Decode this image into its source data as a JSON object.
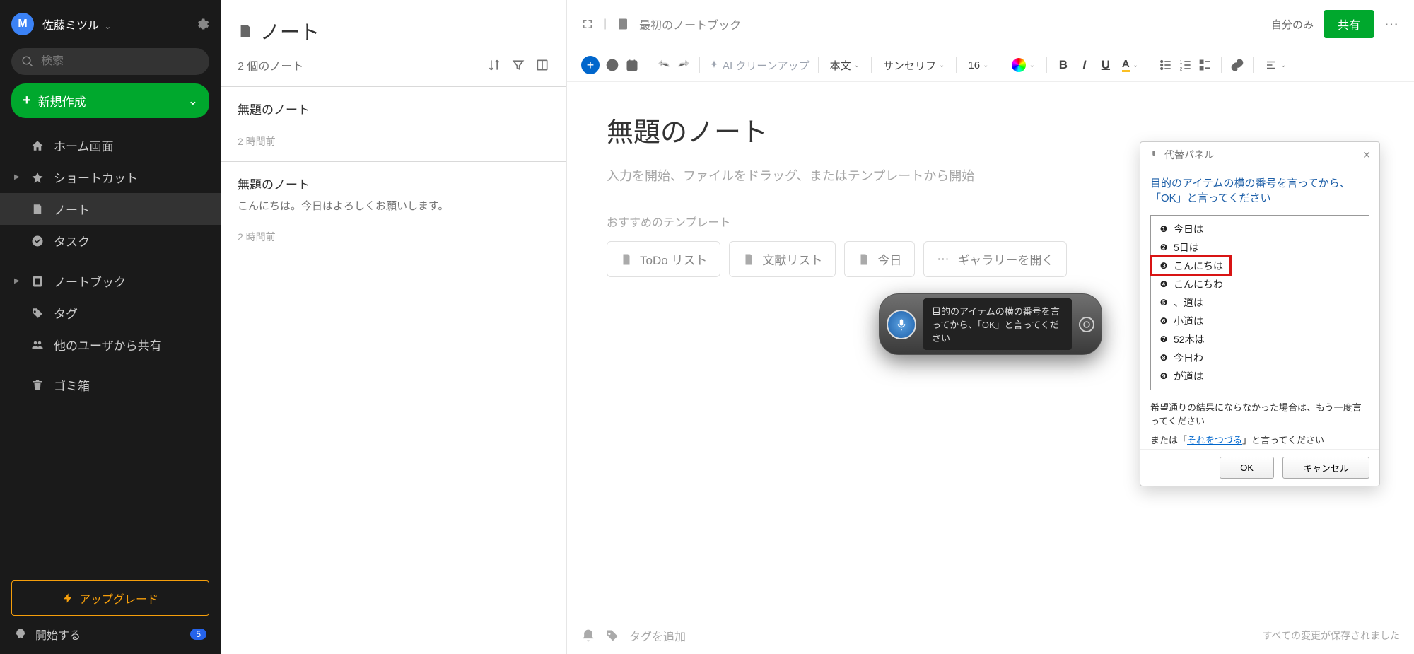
{
  "sidebar": {
    "avatar_letter": "M",
    "username": "佐藤ミツル",
    "search_placeholder": "検索",
    "new_button": "新規作成",
    "nav": {
      "home": "ホーム画面",
      "shortcuts": "ショートカット",
      "notes": "ノート",
      "tasks": "タスク",
      "notebooks": "ノートブック",
      "tags": "タグ",
      "shared": "他のユーザから共有",
      "trash": "ゴミ箱"
    },
    "upgrade": "アップグレード",
    "getstarted": "開始する",
    "getstarted_badge": "5"
  },
  "notelist": {
    "title": "ノート",
    "count": "2 個のノート",
    "items": [
      {
        "title": "無題のノート",
        "preview": "",
        "time": "2 時間前"
      },
      {
        "title": "無題のノート",
        "preview": "こんにちは。今日はよろしくお願いします。",
        "time": "2 時間前"
      }
    ]
  },
  "editor": {
    "notebook": "最初のノートブック",
    "visibility": "自分のみ",
    "share": "共有",
    "toolbar": {
      "ai": "AI クリーンアップ",
      "style": "本文",
      "font": "サンセリフ",
      "size": "16"
    },
    "doc_title": "無題のノート",
    "placeholder": "入力を開始、ファイルをドラッグ、またはテンプレートから開始",
    "templates_label": "おすすめのテンプレート",
    "templates": [
      "ToDo リスト",
      "文献リスト",
      "今日",
      "ギャラリーを開く"
    ],
    "tag_add": "タグを追加",
    "save_status": "すべての変更が保存されました"
  },
  "voice": {
    "text": "目的のアイテムの横の番号を言ってから、「OK」と言ってください"
  },
  "panel": {
    "title": "代替パネル",
    "instruction": "目的のアイテムの横の番号を言ってから、「OK」と言ってください",
    "items": [
      "今日は",
      "5日は",
      "こんにちは",
      "こんにちわ",
      "、道は",
      "小道は",
      "52木は",
      "今日わ",
      "が道は"
    ],
    "highlight_index": 2,
    "retry": "希望通りの結果にならなかった場合は、もう一度言ってください",
    "or_prefix": "または「",
    "spell_link": "それをつづる",
    "or_suffix": "」と言ってください",
    "ok": "OK",
    "cancel": "キャンセル"
  }
}
